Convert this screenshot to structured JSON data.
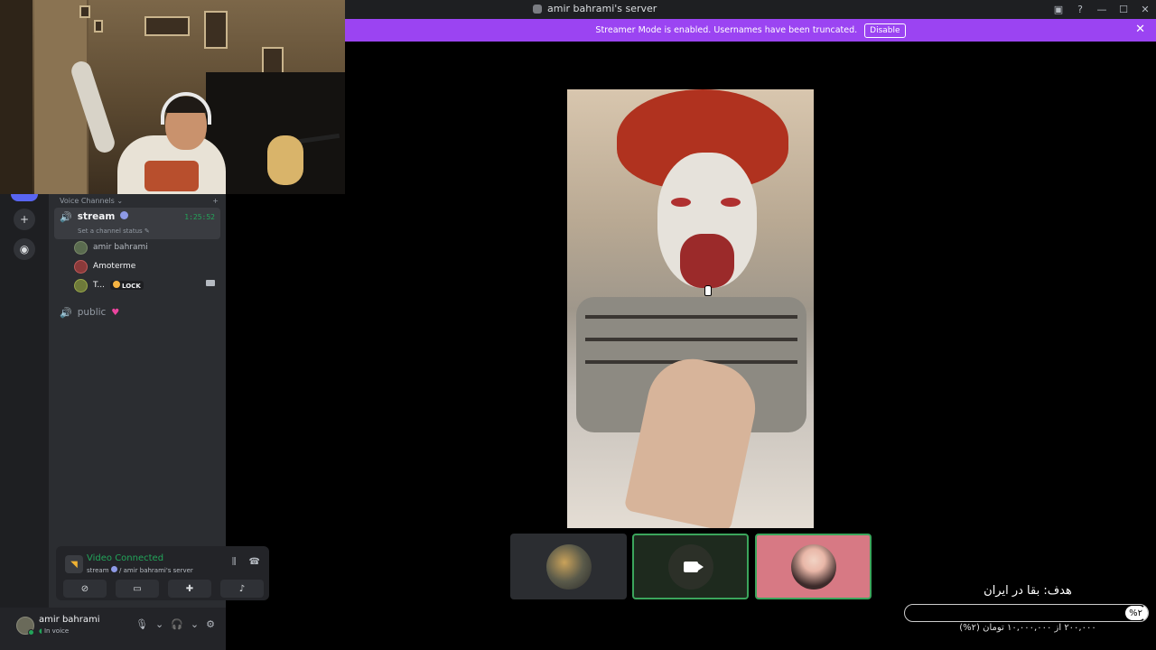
{
  "window": {
    "title": "amir bahrami's server"
  },
  "banner": {
    "message": "Streamer Mode is enabled. Usernames have been truncated.",
    "disable_label": "Disable"
  },
  "sidebar": {
    "category": "Voice Channels",
    "channels": [
      {
        "name": "stream",
        "timer": "1:25:52",
        "status_placeholder": "Set a channel status",
        "members": [
          {
            "name": "amir bahrami"
          },
          {
            "name": "Amoterme"
          },
          {
            "name": "T...",
            "tag": "LOCK"
          }
        ]
      },
      {
        "name": "public"
      }
    ]
  },
  "voice_panel": {
    "title": "Video Connected",
    "channel": "stream",
    "server": "amir bahrami's server",
    "separator": "/"
  },
  "user": {
    "name": "amir bahrami",
    "status": "In voice"
  },
  "goal": {
    "title": "هدف: بقا در ایران",
    "percent_label": "%۲",
    "amount_label": "۲۰۰,۰۰۰ از ۱۰,۰۰۰,۰۰۰ تومان (۲%)",
    "progress": 0.02
  }
}
